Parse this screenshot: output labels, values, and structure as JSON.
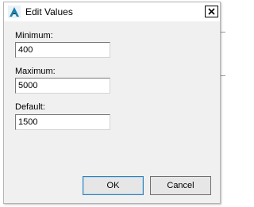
{
  "dialog": {
    "title": "Edit Values",
    "app_icon": "autodesk-a-icon",
    "close_icon": "close-icon"
  },
  "fields": [
    {
      "label": "Minimum:",
      "value": "400"
    },
    {
      "label": "Maximum:",
      "value": "5000"
    },
    {
      "label": "Default:",
      "value": "1500"
    }
  ],
  "buttons": {
    "ok_label": "OK",
    "cancel_label": "Cancel"
  },
  "colors": {
    "dialog_bg": "#f0f0f0",
    "icon_accent": "#1f7ea8"
  }
}
